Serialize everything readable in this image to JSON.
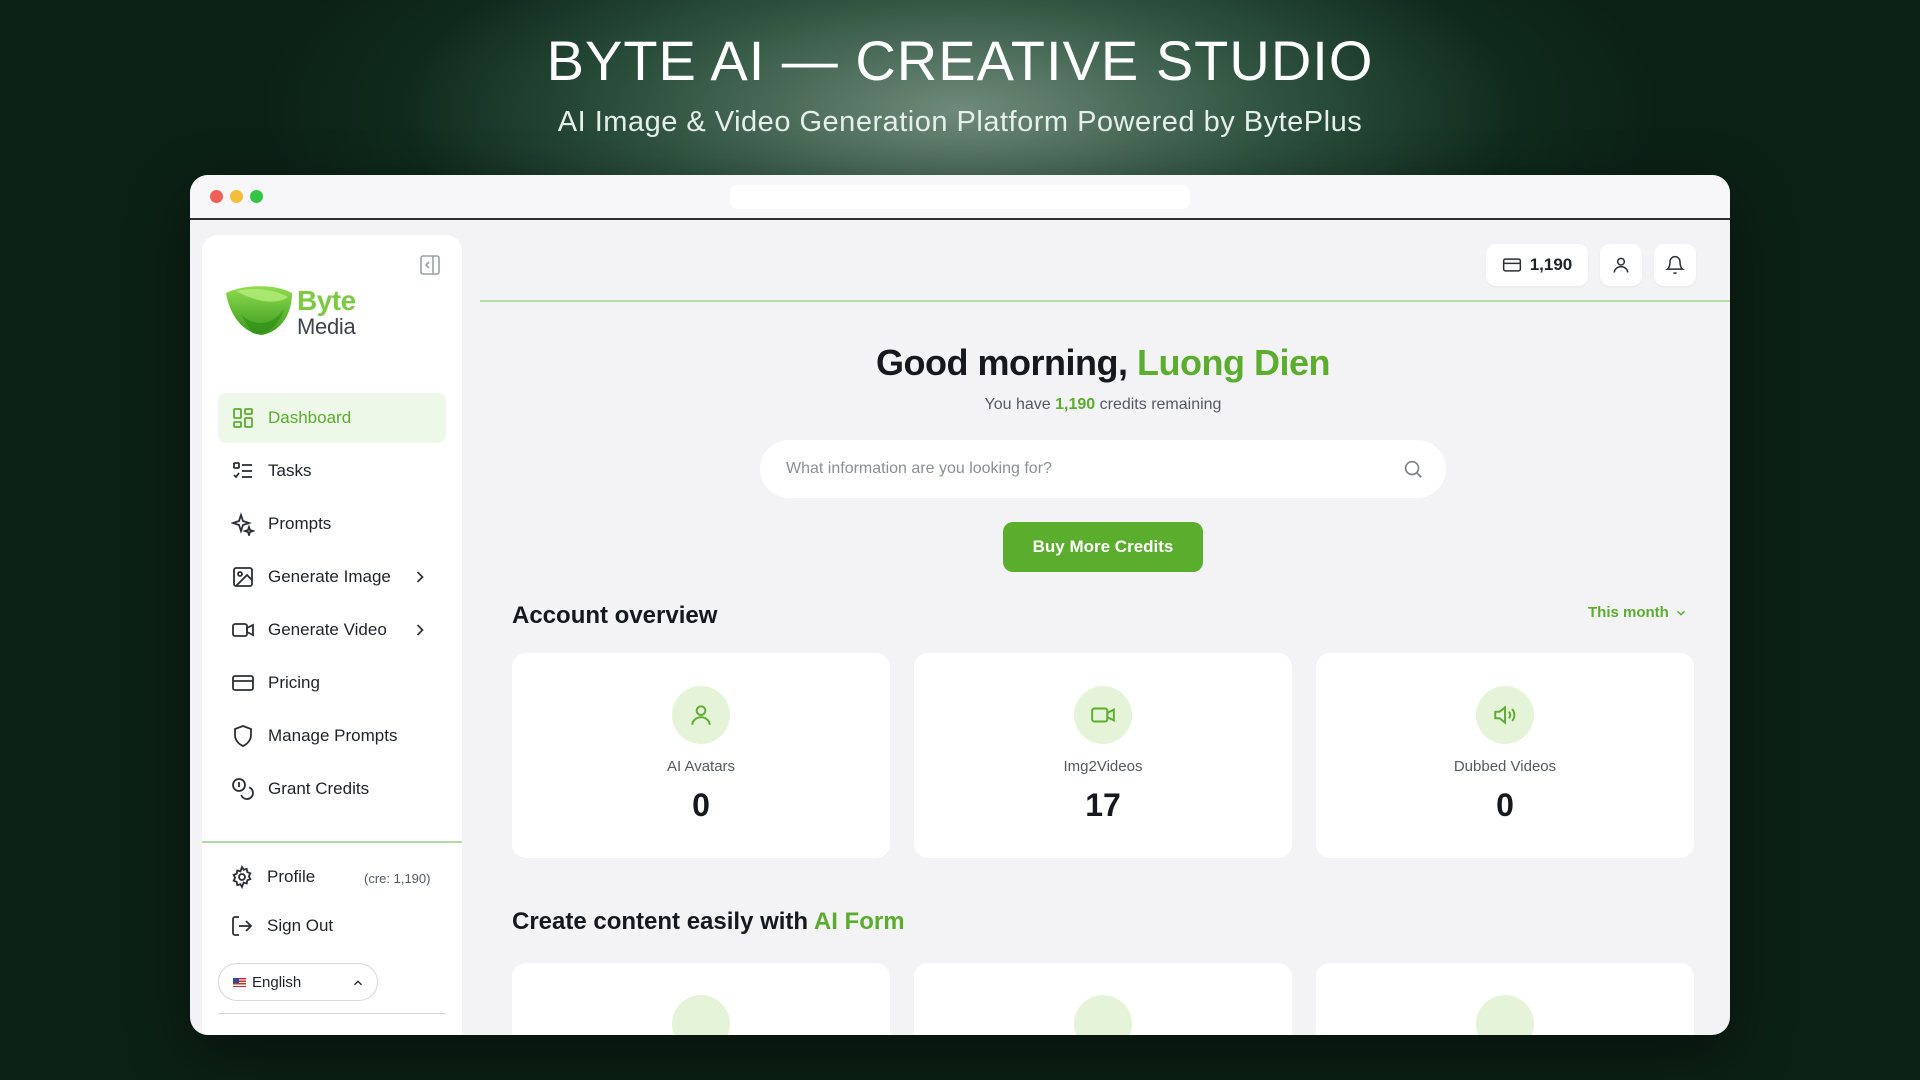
{
  "hero": {
    "title": "BYTE AI — CREATIVE STUDIO",
    "subtitle": "AI Image & Video Generation Platform Powered by BytePlus"
  },
  "brand": {
    "line1": "Byte",
    "line2": "Media",
    "accent_color": "#5aad2d"
  },
  "sidebar": {
    "items": [
      {
        "label": "Dashboard",
        "icon": "dashboard-icon",
        "active": true
      },
      {
        "label": "Tasks",
        "icon": "tasks-icon"
      },
      {
        "label": "Prompts",
        "icon": "sparkles-icon"
      },
      {
        "label": "Generate Image",
        "icon": "image-icon",
        "has_submenu": true
      },
      {
        "label": "Generate Video",
        "icon": "video-icon",
        "has_submenu": true
      },
      {
        "label": "Pricing",
        "icon": "credit-card-icon"
      },
      {
        "label": "Manage Prompts",
        "icon": "shield-icon"
      },
      {
        "label": "Grant Credits",
        "icon": "coins-icon"
      }
    ],
    "profile_label": "Profile",
    "profile_credits": "(cre: 1,190)",
    "signout_label": "Sign Out",
    "language": "English"
  },
  "topbar": {
    "credits": "1,190"
  },
  "main": {
    "greeting_prefix": "Good morning, ",
    "user_name": "Luong Dien",
    "credits_prefix": "You have ",
    "credits_value": "1,190",
    "credits_suffix": " credits remaining",
    "search_placeholder": "What information are you looking for?",
    "buy_button": "Buy More Credits"
  },
  "overview": {
    "title": "Account overview",
    "period": "This month",
    "cards": [
      {
        "label": "AI Avatars",
        "value": "0",
        "icon": "user-icon"
      },
      {
        "label": "Img2Videos",
        "value": "17",
        "icon": "video-icon"
      },
      {
        "label": "Dubbed Videos",
        "value": "0",
        "icon": "speaker-icon"
      }
    ]
  },
  "create": {
    "title_prefix": "Create content easily with ",
    "title_accent": "AI Form"
  }
}
